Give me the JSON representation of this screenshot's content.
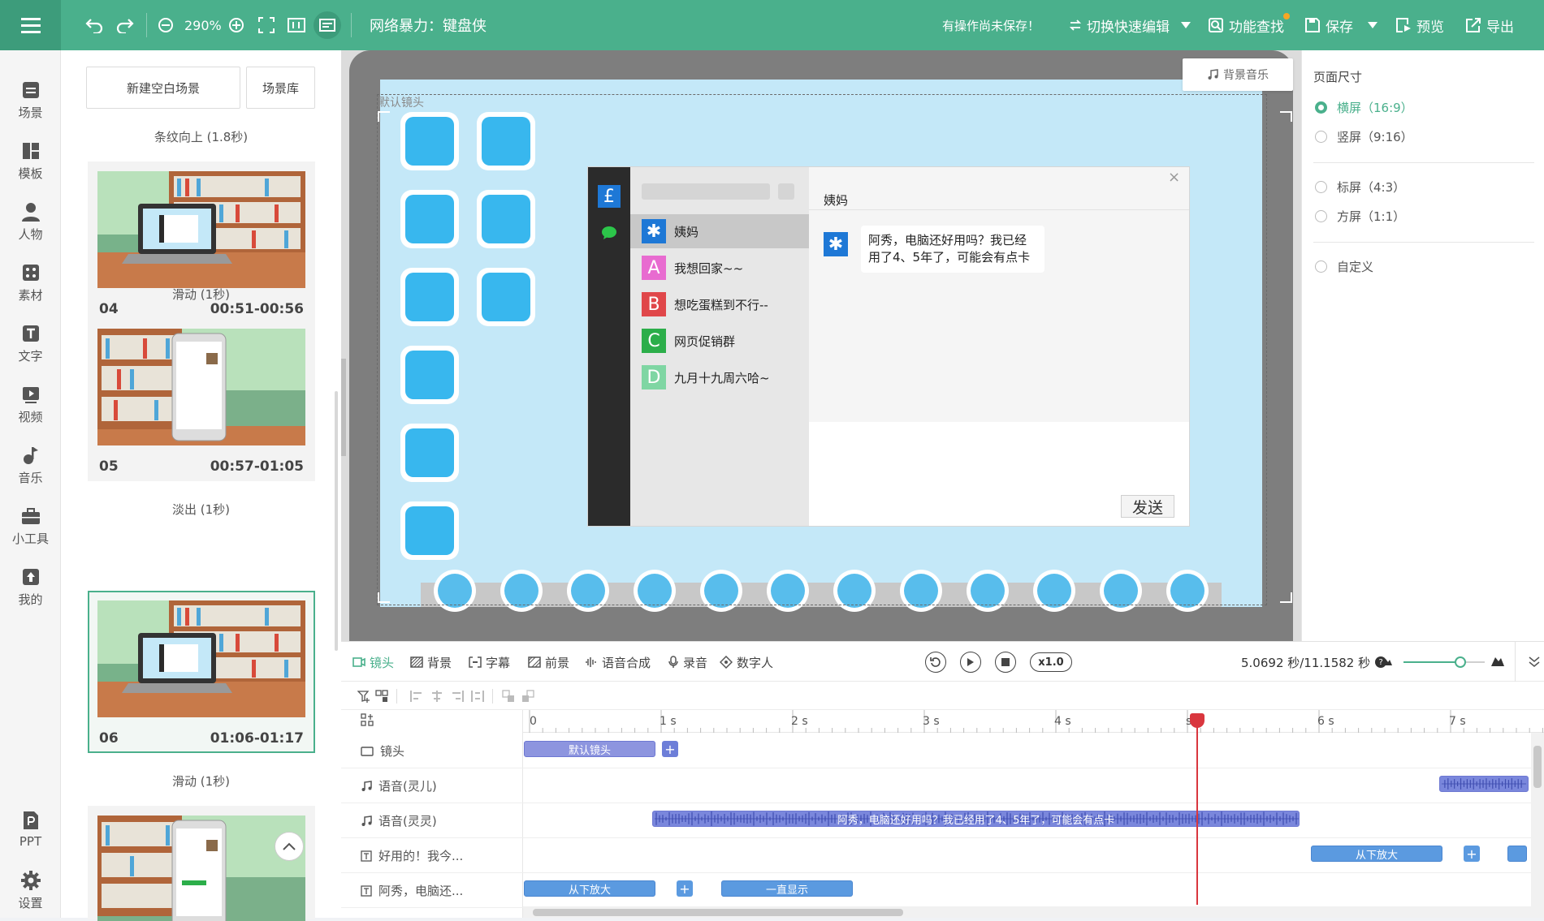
{
  "topbar": {
    "zoom": "290%",
    "project_title": "网络暴力：键盘侠",
    "unsaved_notice": "有操作尚未保存！",
    "switch_mode_label": "切换快速编辑",
    "feature_search_label": "功能查找",
    "save_label": "保存",
    "preview_label": "预览",
    "export_label": "导出"
  },
  "leftnav": {
    "items": [
      {
        "label": "场景",
        "icon": "scene-icon"
      },
      {
        "label": "模板",
        "icon": "template-icon"
      },
      {
        "label": "人物",
        "icon": "person-icon"
      },
      {
        "label": "素材",
        "icon": "material-icon"
      },
      {
        "label": "文字",
        "icon": "text-icon"
      },
      {
        "label": "视频",
        "icon": "video-icon"
      },
      {
        "label": "音乐",
        "icon": "music-icon"
      },
      {
        "label": "小工具",
        "icon": "toolbox-icon"
      },
      {
        "label": "我的",
        "icon": "upload-icon"
      }
    ],
    "bottom": [
      {
        "label": "PPT",
        "icon": "ppt-icon"
      },
      {
        "label": "设置",
        "icon": "gear-icon"
      }
    ]
  },
  "scenes": {
    "new_blank_label": "新建空白场景",
    "library_label": "场景库",
    "transitions": [
      "条纹向上 (1.8秒)",
      "滑动 (1秒)",
      "淡出 (1秒)",
      "滑动 (1秒)"
    ],
    "cards": [
      {
        "num": "04",
        "time": "00:51-00:56"
      },
      {
        "num": "05",
        "time": "00:57-01:05"
      },
      {
        "num": "06",
        "time": "01:06-01:17"
      }
    ]
  },
  "stage": {
    "bg_music_label": "背景音乐",
    "default_camera_label": "默认镜头",
    "chat": {
      "contacts": [
        {
          "letter": "✱",
          "name": "姨妈",
          "color": "#1e78d6"
        },
        {
          "letter": "A",
          "name": "我想回家~~",
          "color": "#e86bd0"
        },
        {
          "letter": "B",
          "name": "想吃蛋糕到不行--",
          "color": "#e0474a"
        },
        {
          "letter": "C",
          "name": "网页促销群",
          "color": "#2cae4a"
        },
        {
          "letter": "D",
          "name": "九月十九周六哈~",
          "color": "#7fd6a3"
        }
      ],
      "active_name": "姨妈",
      "message_line1": "阿秀，电脑还好用吗？我已经",
      "message_line2": "用了4、5年了，可能会有点卡",
      "send_label": "发送"
    }
  },
  "right_panel": {
    "title": "页面尺寸",
    "options": [
      {
        "label": "横屏（16:9）",
        "selected": true
      },
      {
        "label": "竖屏（9:16）",
        "selected": false
      },
      {
        "label": "标屏（4:3）",
        "selected": false
      },
      {
        "label": "方屏（1:1）",
        "selected": false
      },
      {
        "label": "自定义",
        "selected": false
      }
    ]
  },
  "timeline": {
    "tabs": [
      "镜头",
      "背景",
      "字幕",
      "前景",
      "语音合成",
      "录音",
      "数字人"
    ],
    "speed": "x1.0",
    "time_readout": "5.0692 秒/11.1582 秒",
    "ruler": [
      "0",
      "1 s",
      "2 s",
      "3 s",
      "4 s",
      "s",
      "6 s",
      "7 s"
    ],
    "playhead_seconds": 5.0692,
    "tracks": [
      {
        "label": "镜头",
        "icon": "camera-icon"
      },
      {
        "label": "语音(灵儿)",
        "icon": "music-note-icon"
      },
      {
        "label": "语音(灵灵)",
        "icon": "music-note-icon"
      },
      {
        "label": "好用的！我今...",
        "icon": "text-box-icon"
      },
      {
        "label": "阿秀，电脑还...",
        "icon": "text-box-icon"
      }
    ],
    "clips": {
      "camera": "默认镜头",
      "voice2": "阿秀，电脑还好用吗？我已经用了4、5年了，可能会有点卡",
      "text1": "从下放大",
      "text2a": "从下放大",
      "text2b": "一直显示"
    }
  },
  "colors": {
    "accent": "#4ab08c",
    "clip": "#8d95df",
    "playhead": "#d9363e"
  }
}
